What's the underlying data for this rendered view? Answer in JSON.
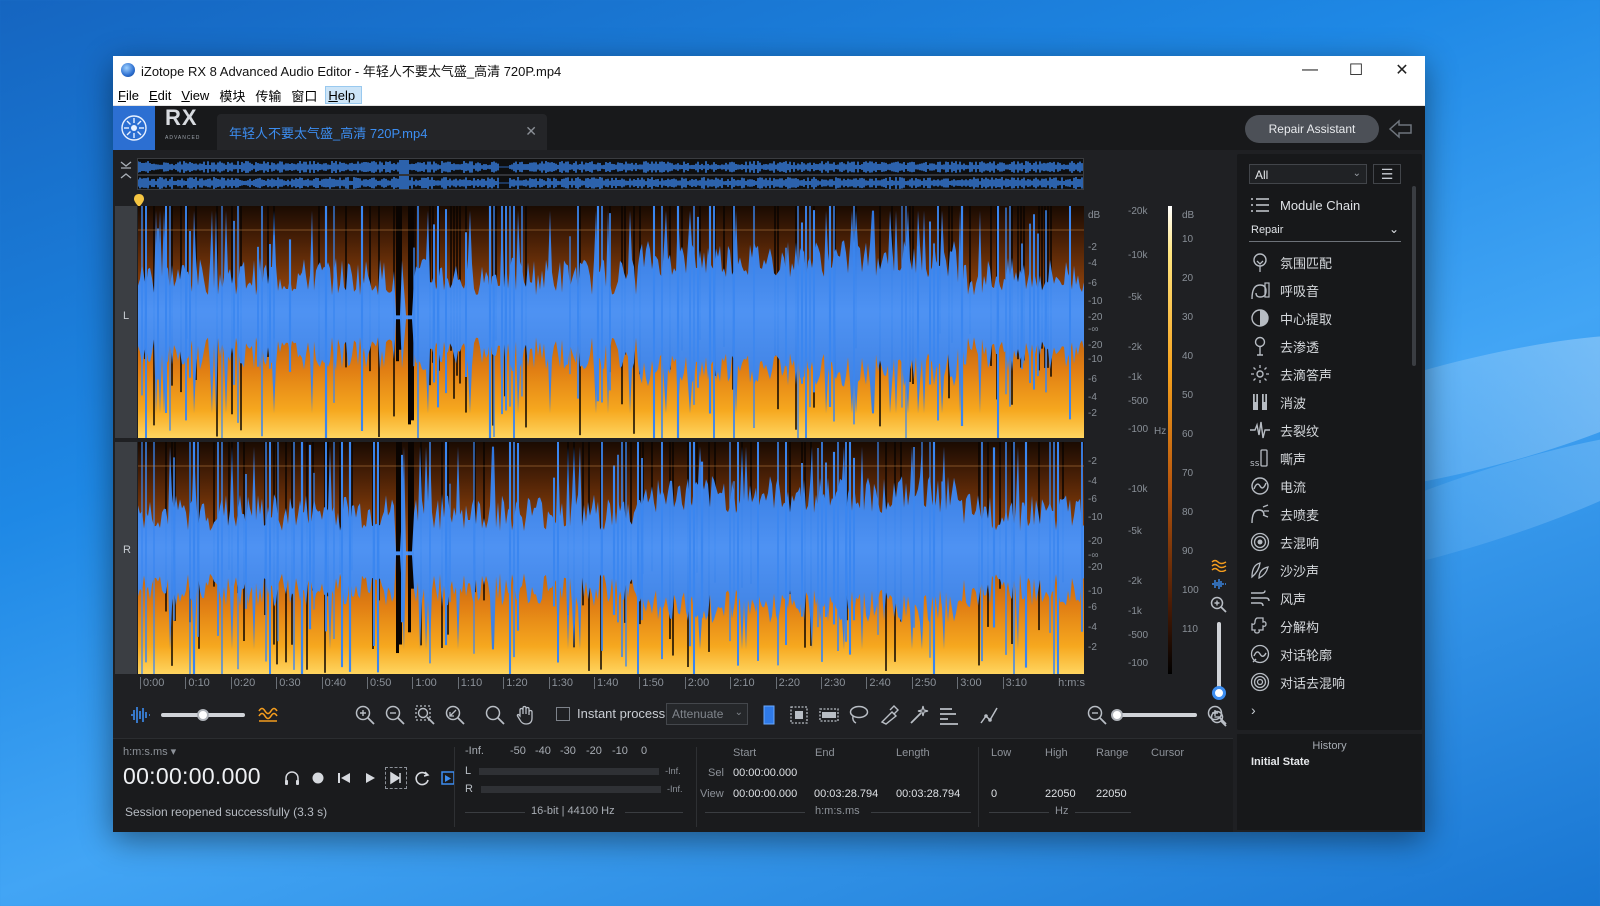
{
  "window": {
    "title": "iZotope RX 8 Advanced Audio Editor - 年轻人不要太气盛_高清 720P.mp4",
    "minimize": "—",
    "maximize": "☐",
    "close": "✕"
  },
  "menu": [
    {
      "u": "F",
      "rest": "ile"
    },
    {
      "u": "E",
      "rest": "dit"
    },
    {
      "u": "V",
      "rest": "iew"
    },
    {
      "u": "",
      "rest": "模块"
    },
    {
      "u": "",
      "rest": "传输"
    },
    {
      "u": "",
      "rest": "窗口"
    },
    {
      "u": "H",
      "rest": "elp"
    }
  ],
  "header": {
    "logo_text": "RX",
    "logo_sub": "ADVANCED",
    "file_tab": "年轻人不要太气盛_高清 720P.mp4",
    "close_tab": "✕",
    "repair_assistant": "Repair Assistant"
  },
  "channels": {
    "left": "L",
    "right": "R"
  },
  "timeline": {
    "ticks": [
      "0:00",
      "0:10",
      "0:20",
      "0:30",
      "0:40",
      "0:50",
      "1:00",
      "1:10",
      "1:20",
      "1:30",
      "1:40",
      "1:50",
      "2:00",
      "2:10",
      "2:20",
      "2:30",
      "2:40",
      "2:50",
      "3:00",
      "3:10"
    ],
    "unit": "h:m:s"
  },
  "db_scale": {
    "top": [
      "dB",
      "-2",
      "-4",
      "-6",
      "-10",
      "-20",
      "-∞",
      "-20",
      "-10",
      "-6",
      "-4",
      "-2"
    ],
    "bottom": [
      "-2",
      "-4",
      "-6",
      "-10",
      "-20",
      "-∞",
      "-20",
      "-10",
      "-6",
      "-4",
      "-2"
    ]
  },
  "hz_scale": {
    "top": [
      "-20k",
      "-10k",
      "-5k",
      "-2k",
      "-1k",
      "-500",
      "-100"
    ],
    "bottom": [
      "-10k",
      "-5k",
      "-2k",
      "-1k",
      "-500",
      "-100"
    ],
    "unit": "Hz"
  },
  "color_scale": {
    "unit": "dB",
    "labels": [
      "10",
      "20",
      "30",
      "40",
      "50",
      "60",
      "70",
      "80",
      "90",
      "100",
      "110"
    ]
  },
  "toolbar": {
    "instant_process": "Instant process",
    "mode_select": "Attenuate"
  },
  "transport": {
    "time_format": "h:m:s.ms",
    "time": "00:00:00.000",
    "status": "Session reopened successfully (3.3 s)"
  },
  "meter": {
    "scale": [
      "-Inf.",
      "-50",
      "-40",
      "-30",
      "-20",
      "-10",
      "0"
    ],
    "left_label": "L",
    "right_label": "R",
    "left_value": "-Inf.",
    "right_value": "-Inf.",
    "format": "16-bit | 44100 Hz"
  },
  "selection": {
    "headers": {
      "start": "Start",
      "end": "End",
      "length": "Length"
    },
    "sel_label": "Sel",
    "view_label": "View",
    "sel_start": "00:00:00.000",
    "view_start": "00:00:00.000",
    "view_end": "00:03:28.794",
    "view_length": "00:03:28.794",
    "unit": "h:m:s.ms"
  },
  "freq": {
    "headers": {
      "low": "Low",
      "high": "High",
      "range": "Range",
      "cursor": "Cursor"
    },
    "low": "0",
    "high": "22050",
    "range": "22050",
    "unit": "Hz"
  },
  "panel": {
    "filter": "All",
    "module_chain": "Module Chain",
    "category": "Repair",
    "modules": [
      {
        "label": "氛围匹配",
        "icon": "ambience-match-icon"
      },
      {
        "label": "呼吸音",
        "icon": "breath-control-icon"
      },
      {
        "label": "中心提取",
        "icon": "center-extract-icon"
      },
      {
        "label": "去渗透",
        "icon": "de-bleed-icon"
      },
      {
        "label": "去滴答声",
        "icon": "de-click-icon"
      },
      {
        "label": "消波",
        "icon": "de-clip-icon"
      },
      {
        "label": "去裂纹",
        "icon": "de-crackle-icon"
      },
      {
        "label": "嘶声",
        "icon": "de-ess-icon"
      },
      {
        "label": "电流",
        "icon": "de-hum-icon"
      },
      {
        "label": "去喷麦",
        "icon": "de-plosive-icon"
      },
      {
        "label": "去混响",
        "icon": "de-reverb-icon"
      },
      {
        "label": "沙沙声",
        "icon": "de-rustle-icon"
      },
      {
        "label": "风声",
        "icon": "de-wind-icon"
      },
      {
        "label": "分解构",
        "icon": "deconstruct-icon"
      },
      {
        "label": "对话轮廓",
        "icon": "dialogue-contour-icon"
      },
      {
        "label": "对话去混响",
        "icon": "dialogue-de-reverb-icon"
      }
    ],
    "more": "›"
  },
  "history": {
    "title": "History",
    "item": "Initial State"
  },
  "colors": {
    "accent": "#3c8df0",
    "waveform": "#3a86f0",
    "spectrogram_hot": "#f3a21a"
  }
}
